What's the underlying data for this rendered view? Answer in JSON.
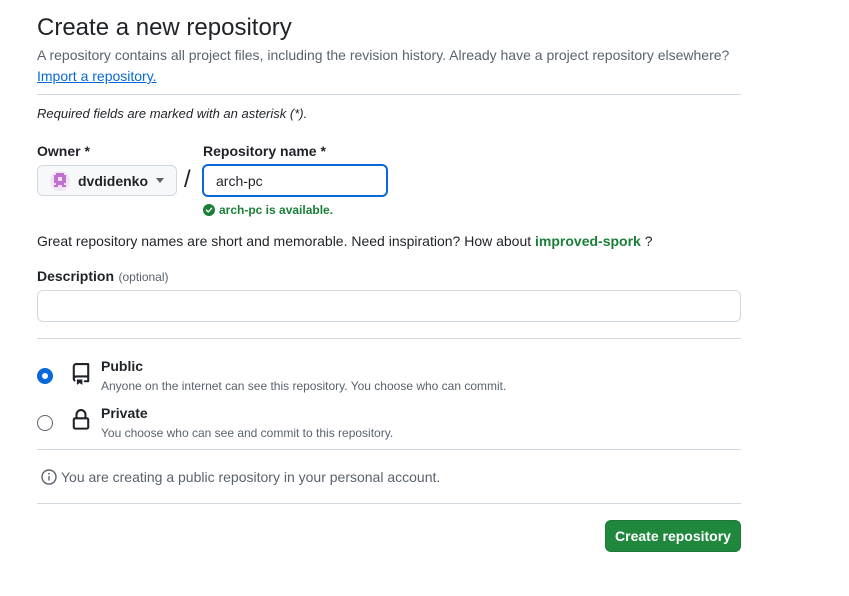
{
  "page_title": "Create a new repository",
  "intro": {
    "text": "A repository contains all project files, including the revision history. Already have a project repository elsewhere?",
    "import_link": "Import a repository."
  },
  "required_note": "Required fields are marked with an asterisk (*).",
  "owner": {
    "label": "Owner *",
    "value": "dvdidenko"
  },
  "separator": "/",
  "repo_name": {
    "label": "Repository name *",
    "value": "arch-pc",
    "availability": "arch-pc is available."
  },
  "suggestion": {
    "text": "Great repository names are short and memorable. Need inspiration? How about",
    "name": "improved-spork",
    "suffix": "?"
  },
  "description": {
    "label": "Description",
    "optional": "(optional)",
    "value": ""
  },
  "visibility": {
    "public": {
      "title": "Public",
      "desc": "Anyone on the internet can see this repository. You choose who can commit.",
      "selected": true
    },
    "private": {
      "title": "Private",
      "desc": "You choose who can see and commit to this repository.",
      "selected": false
    }
  },
  "info_note": "You are creating a public repository in your personal account.",
  "create_button": "Create repository",
  "colors": {
    "accent": "#0969da",
    "success": "#1a7f37",
    "button": "#1f883d",
    "avatar": "#c16fd1"
  },
  "icons": {
    "check": "check-circle-fill-icon",
    "repo": "repo-icon",
    "lock": "lock-icon",
    "info": "info-icon",
    "caret": "triangle-down-icon"
  }
}
